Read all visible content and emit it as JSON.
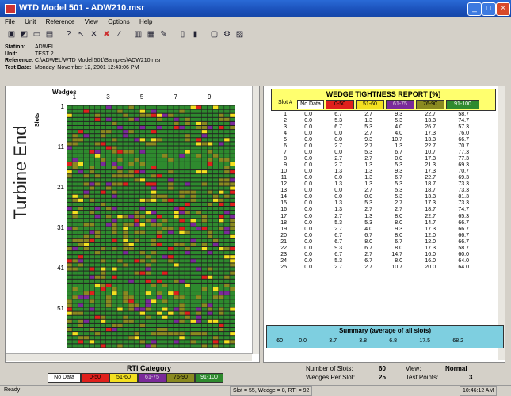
{
  "window": {
    "title": "WTD Model 501 - ADW210.msr"
  },
  "menu": [
    "File",
    "Unit",
    "Reference",
    "View",
    "Options",
    "Help"
  ],
  "info": {
    "station_label": "Station:",
    "station": "ADWEL",
    "unit_label": "Unit:",
    "unit": "TEST 2",
    "reference_label": "Reference:",
    "reference": "C:\\ADWEL\\WTD Model 501\\Samples\\ADW210.msr",
    "testdate_label": "Test Date:",
    "testdate": "Monday, November 12, 2001  12:43:06 PM"
  },
  "left": {
    "turbine_end_label": "Turbine End",
    "wedges_label": "Wedges",
    "slots_label": "Slots",
    "wedge_ticks": [
      "1",
      "3",
      "5",
      "7",
      "9"
    ],
    "slot_ticks": [
      "1",
      "11",
      "21",
      "31",
      "41",
      "51"
    ]
  },
  "report": {
    "title": "WEDGE TIGHTNESS REPORT [%]",
    "slot_header": "Slot #",
    "categories": [
      "No Data",
      "0-50",
      "51-60",
      "61-75",
      "76-90",
      "91-100"
    ],
    "rows": [
      [
        "1",
        "0.0",
        "6.7",
        "2.7",
        "9.3",
        "22.7",
        "58.7"
      ],
      [
        "2",
        "0.0",
        "5.3",
        "1.3",
        "5.3",
        "13.3",
        "74.7"
      ],
      [
        "3",
        "0.0",
        "6.7",
        "5.3",
        "4.0",
        "26.7",
        "57.3"
      ],
      [
        "4",
        "0.0",
        "0.0",
        "2.7",
        "4.0",
        "17.3",
        "76.0"
      ],
      [
        "5",
        "0.0",
        "0.0",
        "9.3",
        "10.7",
        "13.3",
        "66.7"
      ],
      [
        "6",
        "0.0",
        "2.7",
        "2.7",
        "1.3",
        "22.7",
        "70.7"
      ],
      [
        "7",
        "0.0",
        "0.0",
        "5.3",
        "6.7",
        "10.7",
        "77.3"
      ],
      [
        "8",
        "0.0",
        "2.7",
        "2.7",
        "0.0",
        "17.3",
        "77.3"
      ],
      [
        "9",
        "0.0",
        "2.7",
        "1.3",
        "5.3",
        "21.3",
        "69.3"
      ],
      [
        "10",
        "0.0",
        "1.3",
        "1.3",
        "9.3",
        "17.3",
        "70.7"
      ],
      [
        "11",
        "0.0",
        "0.0",
        "1.3",
        "6.7",
        "22.7",
        "69.3"
      ],
      [
        "12",
        "0.0",
        "1.3",
        "1.3",
        "5.3",
        "18.7",
        "73.3"
      ],
      [
        "13",
        "0.0",
        "0.0",
        "2.7",
        "5.3",
        "18.7",
        "73.3"
      ],
      [
        "14",
        "0.0",
        "0.0",
        "0.0",
        "5.3",
        "13.3",
        "81.3"
      ],
      [
        "15",
        "0.0",
        "1.3",
        "5.3",
        "2.7",
        "17.3",
        "73.3"
      ],
      [
        "16",
        "0.0",
        "1.3",
        "2.7",
        "2.7",
        "18.7",
        "74.7"
      ],
      [
        "17",
        "0.0",
        "2.7",
        "1.3",
        "8.0",
        "22.7",
        "65.3"
      ],
      [
        "18",
        "0.0",
        "5.3",
        "5.3",
        "8.0",
        "14.7",
        "66.7"
      ],
      [
        "19",
        "0.0",
        "2.7",
        "4.0",
        "9.3",
        "17.3",
        "66.7"
      ],
      [
        "20",
        "0.0",
        "6.7",
        "6.7",
        "8.0",
        "12.0",
        "66.7"
      ],
      [
        "21",
        "0.0",
        "6.7",
        "8.0",
        "6.7",
        "12.0",
        "66.7"
      ],
      [
        "22",
        "0.0",
        "9.3",
        "6.7",
        "8.0",
        "17.3",
        "58.7"
      ],
      [
        "23",
        "0.0",
        "6.7",
        "2.7",
        "14.7",
        "16.0",
        "60.0"
      ],
      [
        "24",
        "0.0",
        "5.3",
        "6.7",
        "8.0",
        "16.0",
        "64.0"
      ],
      [
        "25",
        "0.0",
        "2.7",
        "2.7",
        "10.7",
        "20.0",
        "64.0"
      ]
    ],
    "summary_title": "Summary (average of all slots)",
    "summary": [
      "60",
      "0.0",
      "3.7",
      "3.8",
      "6.8",
      "17.5",
      "68.2"
    ]
  },
  "rti": {
    "title": "RTI Category",
    "categories": [
      "No Data",
      "0-50",
      "51-60",
      "61-75",
      "76-90",
      "91-100"
    ]
  },
  "stats": {
    "num_slots_label": "Number of Slots:",
    "num_slots": "60",
    "wedges_per_slot_label": "Wedges Per Slot:",
    "wedges_per_slot": "25",
    "view_label": "View:",
    "view": "Normal",
    "test_points_label": "Test Points:",
    "test_points": "3"
  },
  "status": {
    "ready": "Ready",
    "position": "Slot = 55, Wedge = 8, RTI = 92",
    "time": "10:46:12 AM"
  },
  "colors": {
    "nodata": "#ffffff",
    "c0_50": "#e0201c",
    "c51_60": "#f4e020",
    "c61_75": "#7a2a9a",
    "c76_90": "#8a8a20",
    "c91_100": "#2e8a2e"
  }
}
